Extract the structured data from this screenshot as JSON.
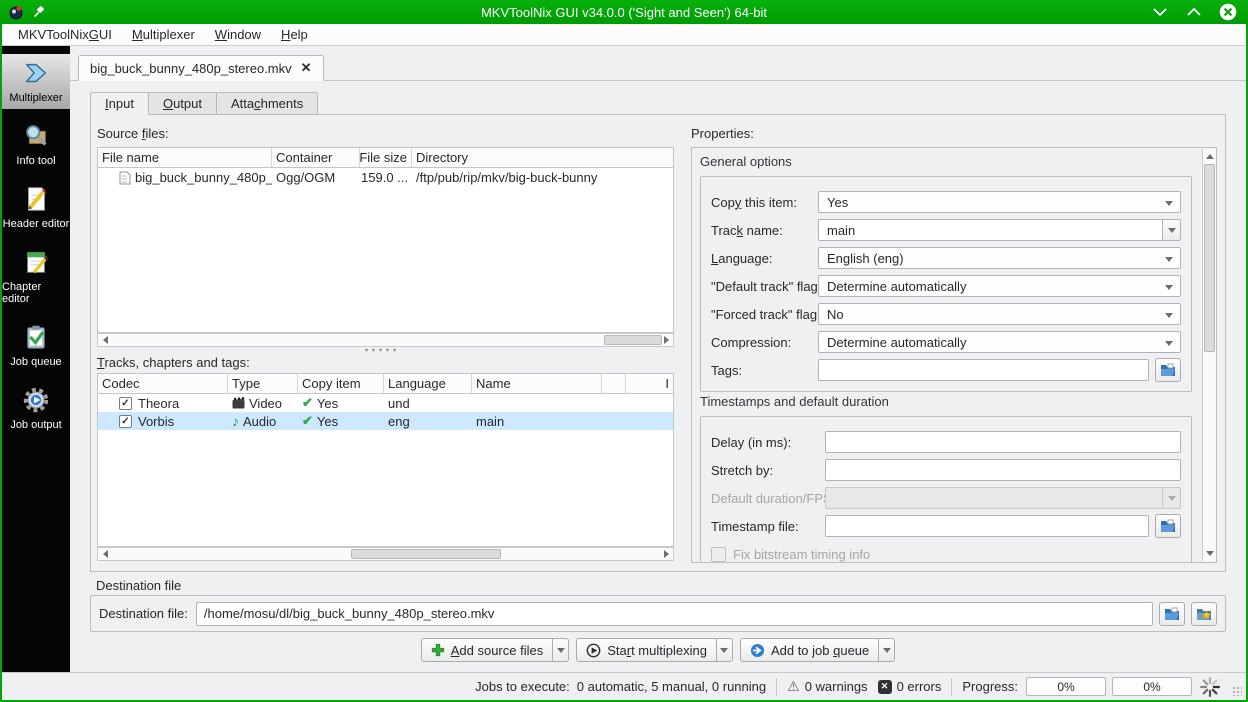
{
  "colors": {
    "accent_green": "#00a406",
    "selection": "#cde8ff"
  },
  "titlebar": {
    "title": "MKVToolNix GUI v34.0.0 ('Sight and Seen') 64-bit"
  },
  "menu": {
    "items": [
      {
        "label": "MKVToolNix GUI",
        "mn": 11
      },
      {
        "label": "Multiplexer",
        "mn": 0
      },
      {
        "label": "Window",
        "mn": 0
      },
      {
        "label": "Help",
        "mn": 0
      }
    ]
  },
  "sidebar": {
    "items": [
      {
        "label": "Multiplexer"
      },
      {
        "label": "Info tool"
      },
      {
        "label": "Header editor"
      },
      {
        "label": "Chapter editor"
      },
      {
        "label": "Job queue"
      },
      {
        "label": "Job output"
      }
    ]
  },
  "file_tab": {
    "label": "big_buck_bunny_480p_stereo.mkv"
  },
  "subtabs": {
    "items": [
      {
        "label": "Input",
        "mn": 0
      },
      {
        "label": "Output",
        "mn": 0
      },
      {
        "label": "Attachments",
        "mn": 4
      }
    ]
  },
  "source_files": {
    "label": "Source files:",
    "label_mn": 7,
    "columns": [
      "File name",
      "Container",
      "File size",
      "Directory"
    ],
    "row": {
      "file_name": "big_buck_bunny_480p_...",
      "container": "Ogg/OGM",
      "file_size": "159.0 ...",
      "directory": "/ftp/pub/rip/mkv/big-buck-bunny"
    }
  },
  "tracks": {
    "label": "Tracks, chapters and tags:",
    "label_mn": 0,
    "columns": {
      "codec": "Codec",
      "type": "Type",
      "copy": "Copy item",
      "language": "Language",
      "name": "Name",
      "last": "I"
    },
    "rows": [
      {
        "codec": "Theora",
        "type": "Video",
        "copy": "Yes",
        "language": "und",
        "name": ""
      },
      {
        "codec": "Vorbis",
        "type": "Audio",
        "copy": "Yes",
        "language": "eng",
        "name": "main"
      }
    ]
  },
  "properties": {
    "label": "Properties:",
    "general": {
      "title": "General options",
      "copy_item": {
        "label": "Copy this item:",
        "mn": 3,
        "value": "Yes"
      },
      "track_name": {
        "label": "Track name:",
        "mn": 4,
        "value": "main"
      },
      "language": {
        "label": "Language:",
        "mn": 0,
        "value": "English (eng)"
      },
      "default_flag": {
        "label": "\"Default track\" flag:",
        "value": "Determine automatically"
      },
      "forced_flag": {
        "label": "\"Forced track\" flag:",
        "value": "No"
      },
      "compression": {
        "label": "Compression:",
        "value": "Determine automatically"
      },
      "tags": {
        "label": "Tags:",
        "value": ""
      }
    },
    "timestamps": {
      "title": "Timestamps and default duration",
      "delay": {
        "label": "Delay (in ms):",
        "value": ""
      },
      "stretch": {
        "label": "Stretch by:",
        "value": ""
      },
      "default_duration": {
        "label": "Default duration/FPS:",
        "value": ""
      },
      "timestamp_file": {
        "label": "Timestamp file:",
        "value": ""
      },
      "fix_bitstream": {
        "label": "Fix bitstream timing info"
      }
    }
  },
  "destination": {
    "group_title": "Destination file",
    "label": "Destination file:",
    "value": "/home/mosu/dl/big_buck_bunny_480p_stereo.mkv"
  },
  "actions": {
    "add_source": {
      "label": "Add source files",
      "mn": 0
    },
    "start_mux": {
      "label": "Start multiplexing",
      "mn": 3
    },
    "add_queue": {
      "label": "Add to job queue",
      "mn": 11
    }
  },
  "statusbar": {
    "jobs_label": "Jobs to execute:",
    "jobs_value": "0 automatic, 5 manual, 0 running",
    "warnings": "0 warnings",
    "errors": "0 errors",
    "progress_label": "Progress:",
    "progress_left": "0%",
    "progress_right": "0%"
  },
  "icons": {
    "close_tab": "✕",
    "checkmark": "✔",
    "checkbox_check": "✓",
    "music_note": "♪",
    "warning": "⚠",
    "error_x": "✕"
  }
}
